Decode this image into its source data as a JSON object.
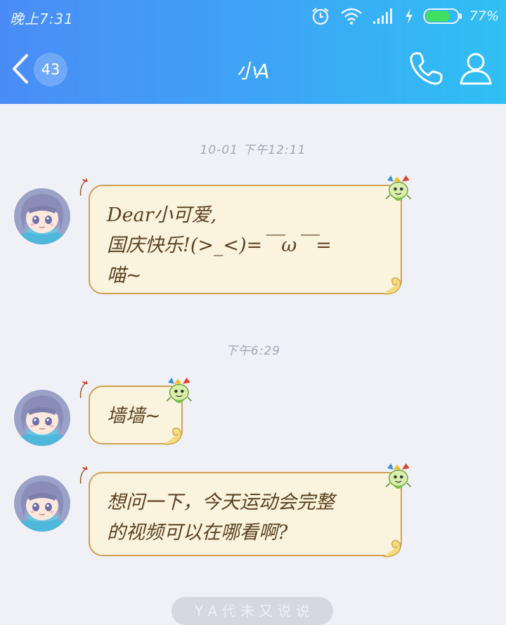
{
  "status_bar": {
    "time": "晚上7:31",
    "battery_percent": "77%",
    "battery_level": 0.77,
    "icons": [
      "alarm-icon",
      "wifi-icon",
      "signal-icon",
      "charging-icon",
      "battery-icon"
    ]
  },
  "header": {
    "back_icon": "chevron-left-icon",
    "unread_count": "43",
    "title": "小A",
    "call_icon": "phone-icon",
    "profile_icon": "user-icon"
  },
  "messages": {
    "ts1": "10-01  下午12:11",
    "m1": "Dear小可爱,\n国庆快乐!(>_<)=￣ω￣=\n喵~",
    "ts2": "下午6:29",
    "m2": "墙墙~",
    "m3": "想问一下，今天运动会完整\n的视频可以在哪看啊?"
  },
  "bottom_tip": "Y A 代 未 又 说 说",
  "colors": {
    "header_start": "#4a8cf6",
    "header_end": "#2fc0f4",
    "bubble_fill": "#faf3de",
    "bubble_border": "#cfa154",
    "bubble_text": "#5b4220",
    "background": "#f0f1f6"
  }
}
